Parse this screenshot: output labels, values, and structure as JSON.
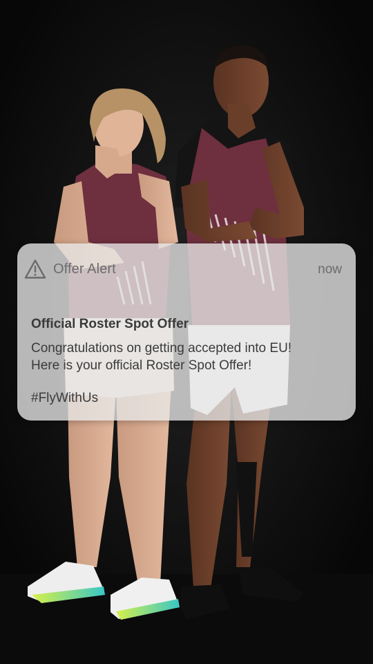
{
  "notification": {
    "app_name": "Offer Alert",
    "app_icon": "warning-triangle-icon",
    "time": "now",
    "title": "Official Roster Spot Offer",
    "body_lines": [
      "Congratulations on getting accepted into EU!",
      "Here is your official Roster Spot Offer!"
    ],
    "hashtag": "#FlyWithUs"
  },
  "colors": {
    "background": "#111111",
    "jersey": "#6e2f3e",
    "notification_bg": "#e8e8e8",
    "notification_text": "#3a3a3a",
    "notification_meta": "#6b6b6b"
  }
}
